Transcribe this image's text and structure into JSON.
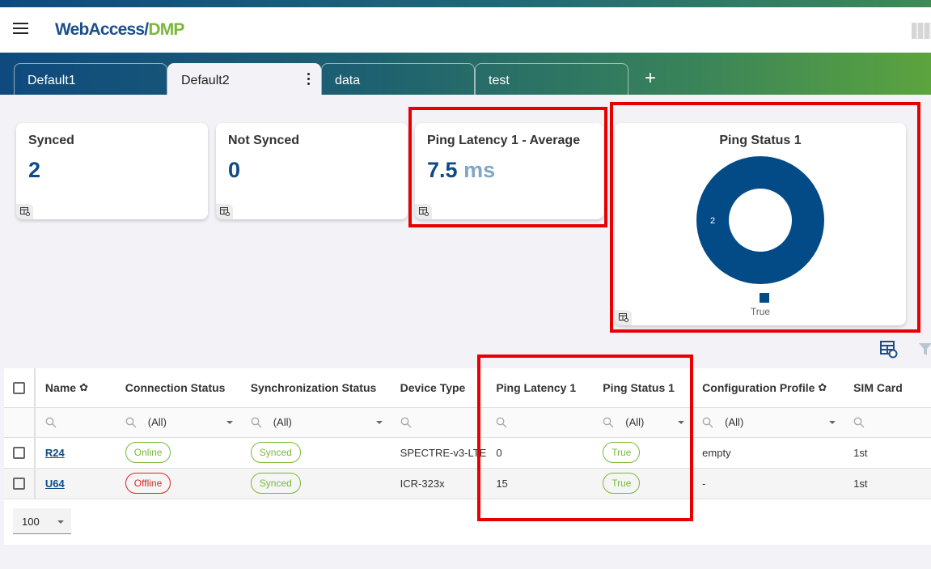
{
  "app": {
    "logo_main": "WebAccess/",
    "logo_accent": "DMP"
  },
  "tabs": [
    {
      "label": "Default1",
      "active": false
    },
    {
      "label": "Default2",
      "active": true
    },
    {
      "label": "data",
      "active": false
    },
    {
      "label": "test",
      "active": false
    }
  ],
  "add_tab_label": "+",
  "widgets": {
    "synced": {
      "title": "Synced",
      "value": "2"
    },
    "not_synced": {
      "title": "Not Synced",
      "value": "0"
    },
    "ping_latency_avg": {
      "title": "Ping Latency 1 - Average",
      "value": "7.5",
      "unit": "ms"
    },
    "ping_status": {
      "title": "Ping Status 1"
    }
  },
  "chart_data": {
    "type": "pie",
    "title": "Ping Status 1",
    "categories": [
      "True"
    ],
    "values": [
      2
    ],
    "colors": [
      "#034b86"
    ],
    "donut": true,
    "data_labels": [
      "2"
    ],
    "legend": "bottom"
  },
  "table": {
    "columns": [
      {
        "label": "Name",
        "gear": true
      },
      {
        "label": "Connection Status",
        "gear": false
      },
      {
        "label": "Synchronization Status",
        "gear": false
      },
      {
        "label": "Device Type",
        "gear": false
      },
      {
        "label": "Ping Latency 1",
        "gear": false
      },
      {
        "label": "Ping Status 1",
        "gear": false
      },
      {
        "label": "Configuration Profile",
        "gear": true
      },
      {
        "label": "SIM Card",
        "gear": false
      }
    ],
    "filters": [
      "",
      "(All)",
      "(All)",
      "",
      "",
      "(All)",
      "(All)",
      ""
    ],
    "rows": [
      {
        "name": "R24",
        "connection": "Online",
        "sync": "Synced",
        "device_type": "SPECTRE-v3-LTE",
        "ping_latency": "0",
        "ping_status": "True",
        "config_profile": "empty",
        "sim": "1st"
      },
      {
        "name": "U64",
        "connection": "Offline",
        "sync": "Synced",
        "device_type": "ICR-323x",
        "ping_latency": "15",
        "ping_status": "True",
        "config_profile": "-",
        "sim": "1st"
      }
    ]
  },
  "pager": {
    "page_size": "100"
  },
  "gear_glyph": "✿"
}
